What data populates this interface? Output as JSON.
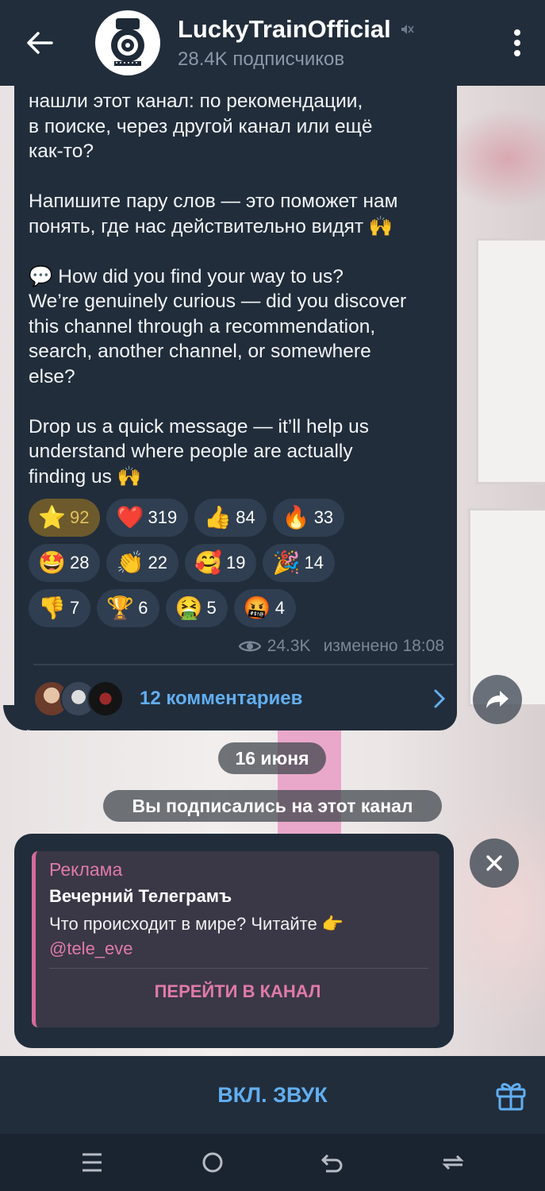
{
  "header": {
    "title": "LuckyTrainOfficial",
    "subtitle": "28.4K подписчиков",
    "icons": {
      "back": "arrow-left-icon",
      "muted": "muted-icon",
      "menu": "more-vertical-icon"
    }
  },
  "message": {
    "text": "нашли этот канал: по рекомендации,\nв поиске, через другой канал или ещё\nкак-то?\n\nНапишите пару слов — это поможет нам\nпонять, где нас действительно видят 🙌\n\n💬 How did you find your way to us?\nWe’re genuinely curious — did you discover\nthis channel through a recommendation,\nsearch, another channel, or somewhere\nelse?\n\nDrop us a quick message — it’ll help us\nunderstand where people are actually\nfinding us 🙌",
    "reactions": [
      [
        {
          "emoji": "⭐",
          "count": "92",
          "active": true
        },
        {
          "emoji": "❤️",
          "count": "319"
        },
        {
          "emoji": "👍",
          "count": "84"
        },
        {
          "emoji": "🔥",
          "count": "33"
        }
      ],
      [
        {
          "emoji": "🤩",
          "count": "28"
        },
        {
          "emoji": "👏",
          "count": "22"
        },
        {
          "emoji": "🥰",
          "count": "19"
        },
        {
          "emoji": "🎉",
          "count": "14"
        }
      ],
      [
        {
          "emoji": "👎",
          "count": "7"
        },
        {
          "emoji": "🏆",
          "count": "6"
        },
        {
          "emoji": "🤮",
          "count": "5"
        },
        {
          "emoji": "🤬",
          "count": "4"
        }
      ]
    ],
    "views": "24.3K",
    "edited": "изменено 18:08",
    "comments_label": "12 комментариев"
  },
  "service": {
    "date": "16 июня",
    "subscribed": "Вы подписались на этот канал"
  },
  "ad": {
    "label": "Реклама",
    "title": "Вечерний Телеграмъ",
    "text": "Что происходит в мире? Читайте 👉",
    "link": "@tele_eve",
    "cta": "ПЕРЕЙТИ В КАНАЛ"
  },
  "bottom": {
    "unmute_label": "ВКЛ. ЗВУК"
  },
  "colors": {
    "panel": "#212d3b",
    "accent": "#62aef0",
    "ad_accent": "#e07aa8",
    "active_reaction": "#6c5a2c"
  }
}
